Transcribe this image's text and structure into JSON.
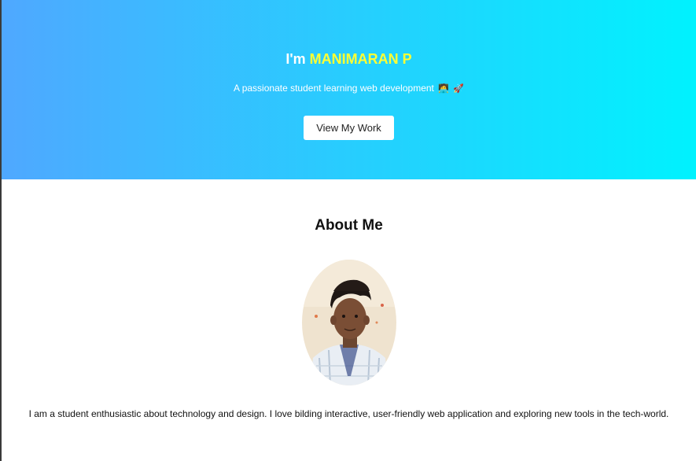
{
  "hero": {
    "greeting": "I'm ",
    "name": "MANIMARAN P",
    "subtitle": "A passionate student learning web development",
    "emoji_1": "🧑‍💻",
    "emoji_2": "🚀",
    "button_label": "View My Work",
    "colors": {
      "gradient_start": "#4fa8ff",
      "gradient_end": "#00f2fe",
      "name_highlight": "#ffff33"
    }
  },
  "about": {
    "title": "About Me",
    "avatar_alt": "profile-photo",
    "description": "I am a student enthusiastic about technology and design. I love bilding interactive, user-friendly web application and exploring new tools in the tech-world."
  }
}
